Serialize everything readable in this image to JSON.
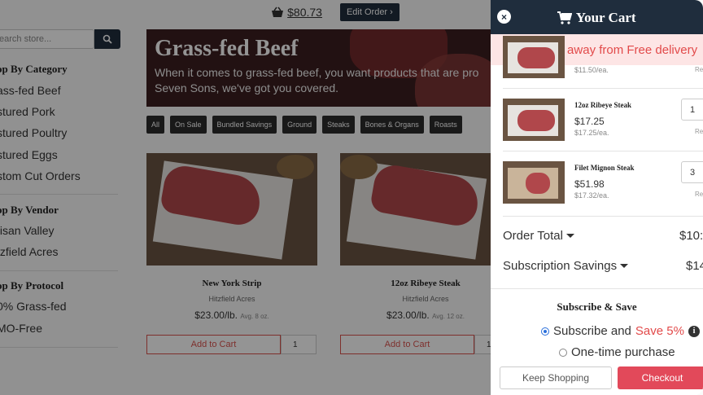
{
  "topbar": {
    "cart_total": "$80.73",
    "edit_order_label": "Edit Order"
  },
  "sidebar": {
    "search_placeholder": "earch store...",
    "category_heading": "op By Category",
    "categories": [
      "ass-fed Beef",
      "stured Pork",
      "stured Poultry",
      "stured Eggs",
      "stom Cut Orders"
    ],
    "vendor_heading": "op By Vendor",
    "vendors": [
      "tisan Valley",
      "tzfield Acres"
    ],
    "protocol_heading": "op By Protocol",
    "protocols": [
      "0% Grass-fed",
      "MO-Free"
    ]
  },
  "hero": {
    "title": "Grass-fed Beef",
    "description": "When it comes to grass-fed beef, you want products that are pro Seven Sons, we've got you covered."
  },
  "filters": [
    "All",
    "On Sale",
    "Bundled Savings",
    "Ground",
    "Steaks",
    "Bones & Organs",
    "Roasts"
  ],
  "products": [
    {
      "name": "New York Strip",
      "vendor": "Hitzfield Acres",
      "price": "$23.00/lb.",
      "avg": "Avg. 8 oz.",
      "add_label": "Add to Cart",
      "qty": "1"
    },
    {
      "name": "12oz Ribeye Steak",
      "vendor": "Hitzfield Acres",
      "price": "$23.00/lb.",
      "avg": "Avg. 12 oz.",
      "add_label": "Add to Cart",
      "qty": "1"
    }
  ],
  "cart": {
    "title": "Your Cart",
    "free_delivery_msg": "$19.27 away from Free delivery",
    "items": [
      {
        "name": "",
        "price": "",
        "each": "$11.50/ea.",
        "qty": "",
        "remove": "Re"
      },
      {
        "name": "12oz Ribeye Steak",
        "price": "$17.25",
        "each": "$17.25/ea.",
        "qty": "1",
        "remove": "Re"
      },
      {
        "name": "Filet Mignon Steak",
        "price": "$51.98",
        "each": "$17.32/ea.",
        "qty": "3",
        "remove": "Re"
      }
    ],
    "order_total_label": "Order Total",
    "order_total_value": "$10:",
    "subscription_savings_label": "Subscription Savings",
    "subscription_savings_value": "$14",
    "subscribe_heading": "Subscribe & Save",
    "subscribe_option": "Subscribe and",
    "subscribe_save": "Save 5%",
    "onetime_option": "One-time purchase",
    "keep_shopping_label": "Keep Shopping",
    "checkout_label": "Checkout"
  },
  "colors": {
    "navy": "#1f2d3d",
    "accent_red": "#e24a4a",
    "banner_bg": "#fde5e5"
  }
}
